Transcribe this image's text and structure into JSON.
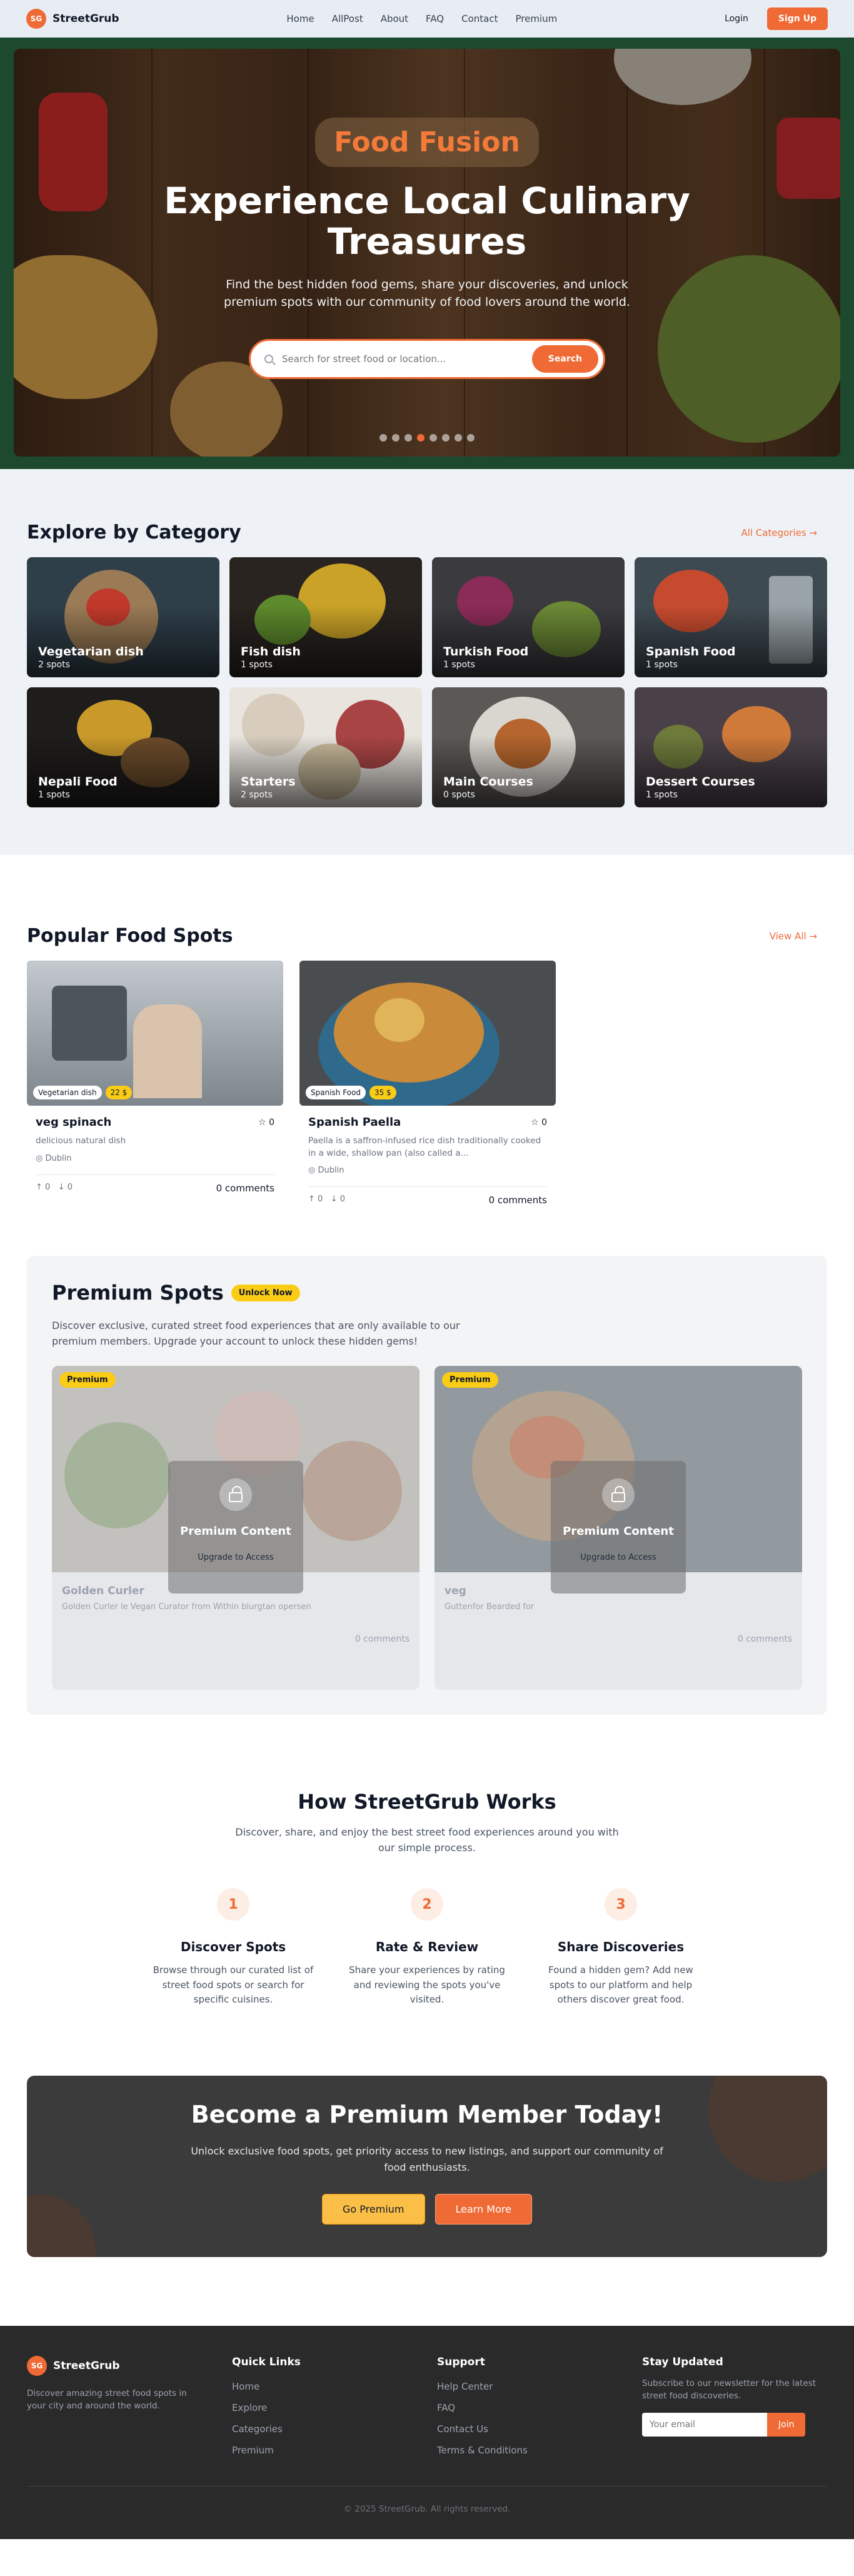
{
  "nav": {
    "logo_text": "SG",
    "brand": "StreetGrub",
    "links": [
      "Home",
      "AllPost",
      "About",
      "FAQ",
      "Contact",
      "Premium"
    ],
    "login": "Login",
    "signup": "Sign Up"
  },
  "hero": {
    "tag": "Food Fusion",
    "title": "Experience Local Culinary Treasures",
    "subtitle": "Find the best hidden food gems, share your discoveries, and unlock premium spots with our community of food lovers around the world.",
    "search_placeholder": "Search for street food or location...",
    "search_button": "Search",
    "slide_count": 8,
    "active_slide": 4
  },
  "categories": {
    "title": "Explore by Category",
    "link": "All Categories  →",
    "items": [
      {
        "name": "Vegetarian dish",
        "count": "2 spots"
      },
      {
        "name": "Fish dish",
        "count": "1 spots"
      },
      {
        "name": "Turkish Food",
        "count": "1 spots"
      },
      {
        "name": "Spanish Food",
        "count": "1 spots"
      },
      {
        "name": "Nepali Food",
        "count": "1 spots"
      },
      {
        "name": "Starters",
        "count": "2 spots"
      },
      {
        "name": "Main Courses",
        "count": "0 spots"
      },
      {
        "name": "Dessert Courses",
        "count": "1 spots"
      }
    ]
  },
  "popular": {
    "title": "Popular Food Spots",
    "link": "View All  →",
    "spots": [
      {
        "category": "Vegetarian dish",
        "price": "22 $",
        "name": "veg spinach",
        "rating": "☆ 0",
        "desc": "delicious natural dish",
        "location": "◎ Dublin",
        "up": "↑ 0",
        "down": "↓ 0",
        "comments": "0 comments"
      },
      {
        "category": "Spanish Food",
        "price": "35 $",
        "name": "Spanish Paella",
        "rating": "☆ 0",
        "desc": "Paella is a saffron-infused rice dish traditionally cooked in a wide, shallow pan (also called a...",
        "location": "◎ Dublin",
        "up": "↑ 0",
        "down": "↓ 0",
        "comments": "0 comments"
      }
    ]
  },
  "premium": {
    "title": "Premium Spots",
    "badge": "Unlock Now",
    "desc": "Discover exclusive, curated street food experiences that are only available to our premium members. Upgrade your account to unlock these hidden gems!",
    "cards": [
      {
        "label": "Premium",
        "lock_title": "Premium Content",
        "lock_sub": "Upgrade to Access",
        "name": "Golden Curler",
        "line": "Golden Curler le Vegan Curator from Within blurgtan opersen",
        "comments": "0 comments"
      },
      {
        "label": "Premium",
        "lock_title": "Premium Content",
        "lock_sub": "Upgrade to Access",
        "name": "veg",
        "line": "Guttenfor Bearded for",
        "comments": "0 comments"
      }
    ]
  },
  "how": {
    "title": "How StreetGrub Works",
    "subtitle": "Discover, share, and enjoy the best street food experiences around you with our simple process.",
    "steps": [
      {
        "num": "1",
        "title": "Discover Spots",
        "text": "Browse through our curated list of street food spots or search for specific cuisines."
      },
      {
        "num": "2",
        "title": "Rate & Review",
        "text": "Share your experiences by rating and reviewing the spots you've visited."
      },
      {
        "num": "3",
        "title": "Share Discoveries",
        "text": "Found a hidden gem? Add new spots to our platform and help others discover great food."
      }
    ]
  },
  "cta": {
    "title": "Become a Premium Member Today!",
    "subtitle": "Unlock exclusive food spots, get priority access to new listings, and support our community of food enthusiasts.",
    "primary": "Go Premium",
    "secondary": "Learn More"
  },
  "footer": {
    "logo_text": "SG",
    "brand": "StreetGrub",
    "desc": "Discover amazing street food spots in your city and around the world.",
    "quick_title": "Quick Links",
    "quick_links": [
      "Home",
      "Explore",
      "Categories",
      "Premium"
    ],
    "support_title": "Support",
    "support_links": [
      "Help Center",
      "FAQ",
      "Contact Us",
      "Terms & Conditions"
    ],
    "news_title": "Stay Updated",
    "news_text": "Subscribe to our newsletter for the latest street food discoveries.",
    "news_placeholder": "Your email",
    "news_button": "Join",
    "copyright": "© 2025 StreetGrub. All rights reserved."
  },
  "colors": {
    "accent": "#f06a35",
    "premium_yellow": "#facc15",
    "dark": "#2a2a2a"
  }
}
